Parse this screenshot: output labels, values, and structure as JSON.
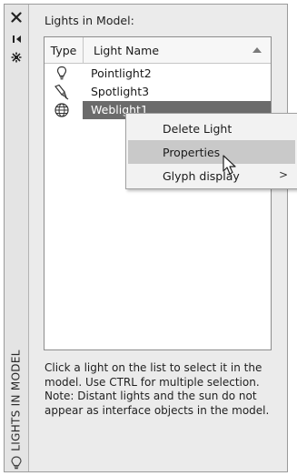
{
  "palette": {
    "vertical_title": "LIGHTS IN MODEL",
    "strip_icons": [
      "close-icon",
      "auto-hide-icon",
      "properties-icon"
    ]
  },
  "list": {
    "section_title": "Lights in Model:",
    "columns": {
      "type": "Type",
      "name": "Light Name"
    },
    "rows": [
      {
        "name": "Pointlight2",
        "icon": "pointlight-icon"
      },
      {
        "name": "Spotlight3",
        "icon": "spotlight-icon"
      },
      {
        "name": "Weblight1",
        "icon": "weblight-icon",
        "selected": true
      }
    ]
  },
  "help": {
    "line1": "Click a light on the list to select it in the model. Use CTRL for multiple selection.",
    "line2": "Note: Distant lights and the sun do not appear as interface objects in the model."
  },
  "context_menu": {
    "items": [
      {
        "label": "Delete Light"
      },
      {
        "label": "Properties",
        "hovered": true
      },
      {
        "label": "Glyph display",
        "submenu_arrow": ">"
      }
    ]
  },
  "colors": {
    "selection": "#6b6b6b",
    "menu_hover": "#c9c9c9",
    "panel_bg": "#ebebeb"
  }
}
